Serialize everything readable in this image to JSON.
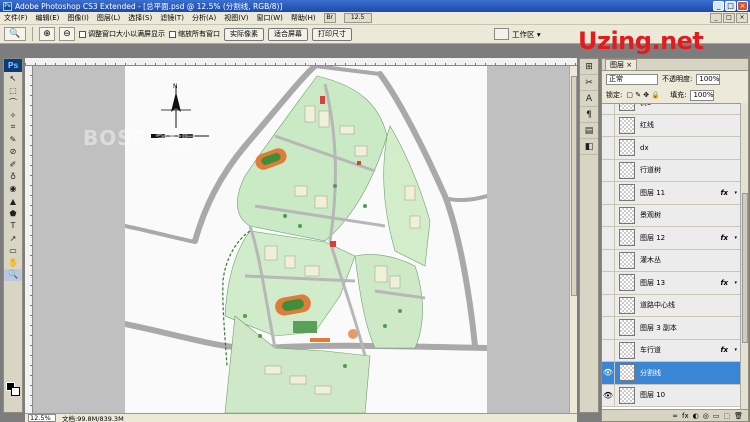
{
  "window": {
    "title": "Adobe Photoshop CS3 Extended - [总平面.psd @ 12.5% (分割线, RGB/8)]",
    "app_icon_text": "Ps",
    "minimize": "_",
    "maximize": "□",
    "close": "×"
  },
  "menu": {
    "items": [
      "文件(F)",
      "编辑(E)",
      "图像(I)",
      "图层(L)",
      "选择(S)",
      "滤镜(T)",
      "分析(A)",
      "视图(V)",
      "窗口(W)",
      "帮助(H)"
    ],
    "bridge_btn": "Br",
    "zoom_dropdown": "12.5"
  },
  "options": {
    "tool_icon": "🔍",
    "zoom_in_icon": "⊕",
    "checkbox1_label": "调整窗口大小以满屏显示",
    "checkbox2_label": "缩放所有窗口",
    "btn_actual_pixels": "实际像素",
    "btn_fit_screen": "适合屏幕",
    "btn_print_size": "打印尺寸",
    "workspace_label": "工作区 ▾"
  },
  "brand": {
    "logo": "Uzing.net",
    "watermark": "BOSS 资源",
    "logo_color": "#e8191d"
  },
  "tools": {
    "logo": "Ps",
    "glyphs": [
      "↖",
      "⬚",
      "⌒",
      "✧",
      "⌗",
      "✎",
      "⊘",
      "✐",
      "♁",
      "◉",
      "▲",
      "⬟",
      "T",
      "↗",
      "▭",
      "✋",
      "🔍"
    ]
  },
  "status": {
    "zoom": "12.5%",
    "doc_info": "文档:99.8M/839.3M"
  },
  "dock": {
    "icons": [
      "⊞",
      "✂",
      "A",
      "¶",
      "▤",
      "◧"
    ]
  },
  "layers_panel": {
    "tab": "图层 ×",
    "blend_mode": "正常",
    "opacity_label": "不透明度:",
    "opacity_value": "100%",
    "lock_label": "锁定:",
    "fill_label": "填充:",
    "fill_value": "100%",
    "footer_icons": [
      "∞",
      "fx",
      "◐",
      "◎",
      "▭",
      "⬚",
      "🗑"
    ],
    "layers": [
      {
        "name": "树5",
        "visible": false,
        "fx": false,
        "selected": false
      },
      {
        "name": "红线",
        "visible": false,
        "fx": false,
        "selected": false
      },
      {
        "name": "dx",
        "visible": false,
        "fx": false,
        "selected": false
      },
      {
        "name": "行道树",
        "visible": false,
        "fx": false,
        "selected": false
      },
      {
        "name": "图层 11",
        "visible": false,
        "fx": true,
        "selected": false
      },
      {
        "name": "景观树",
        "visible": false,
        "fx": false,
        "selected": false
      },
      {
        "name": "图层 12",
        "visible": false,
        "fx": true,
        "selected": false
      },
      {
        "name": "灌木丛",
        "visible": false,
        "fx": false,
        "selected": false
      },
      {
        "name": "图层 13",
        "visible": false,
        "fx": true,
        "selected": false
      },
      {
        "name": "道路中心线",
        "visible": false,
        "fx": false,
        "selected": false
      },
      {
        "name": "图层 3 副本",
        "visible": false,
        "fx": false,
        "selected": false
      },
      {
        "name": "车行道",
        "visible": false,
        "fx": true,
        "selected": false
      },
      {
        "name": "分割线",
        "visible": true,
        "fx": false,
        "selected": true
      },
      {
        "name": "图层 10",
        "visible": true,
        "fx": false,
        "selected": false
      }
    ],
    "eye_icon": "👁",
    "fx_label": "fx",
    "fx_arrow": "▾"
  },
  "compass": {
    "label": "N"
  }
}
